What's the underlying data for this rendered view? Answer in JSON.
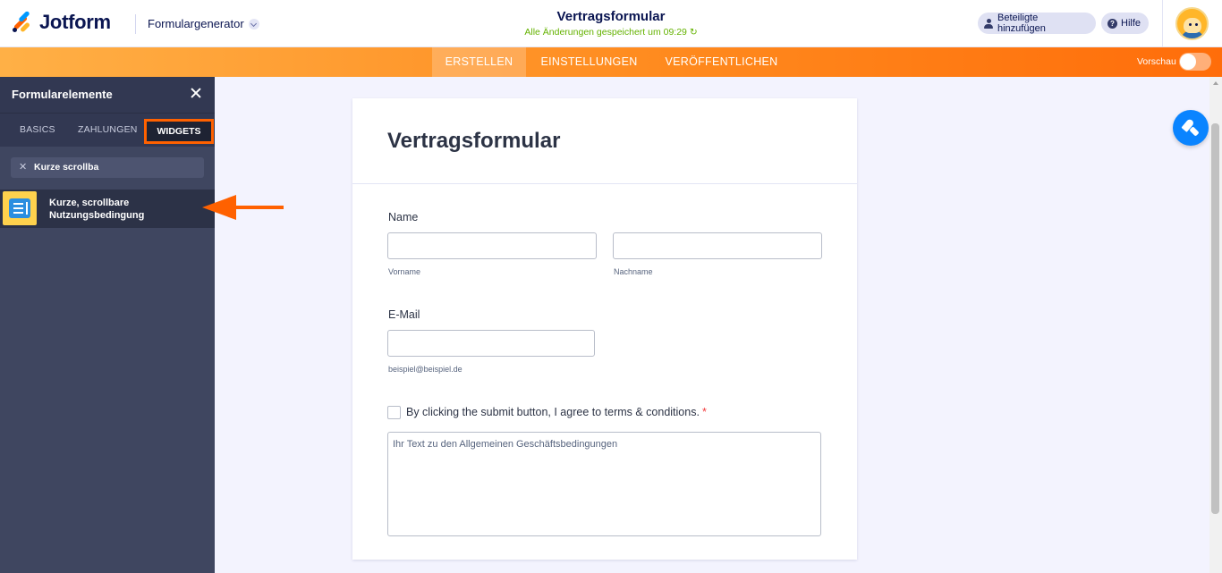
{
  "header": {
    "logo_text": "Jotform",
    "builder_label": "Formulargenerator",
    "form_title": "Vertragsformular",
    "save_status": "Alle Änderungen gespeichert um 09:29 ↻",
    "add_participants_label": "Beteiligte hinzufügen",
    "help_label": "Hilfe"
  },
  "nav": {
    "tabs": [
      {
        "label": "ERSTELLEN",
        "active": true
      },
      {
        "label": "EINSTELLUNGEN",
        "active": false
      },
      {
        "label": "VERÖFFENTLICHEN",
        "active": false
      }
    ],
    "preview_label": "Vorschau",
    "preview_enabled": false
  },
  "sidebar": {
    "title": "Formularelemente",
    "tabs": [
      {
        "label": "BASICS"
      },
      {
        "label": "ZAHLUNGEN"
      },
      {
        "label": "WIDGETS",
        "active": true
      }
    ],
    "search_value": "Kurze scrollba",
    "results": [
      {
        "label": "Kurze, scrollbare Nutzungsbedingung"
      }
    ]
  },
  "form": {
    "title": "Vertragsformular",
    "name_label": "Name",
    "first_name_sublabel": "Vorname",
    "last_name_sublabel": "Nachname",
    "email_label": "E-Mail",
    "email_sublabel": "beispiel@beispiel.de",
    "terms_checkbox_label": "By clicking the submit button, I agree to terms & conditions.",
    "required_mark": "*",
    "terms_text": "Ihr Text zu den Allgemeinen Geschäftsbedingungen"
  },
  "colors": {
    "accent_orange": "#ff6100",
    "brand_navy": "#0a1551",
    "save_green": "#64b200",
    "fab_blue": "#0a84ff"
  },
  "icons": {
    "search_clear": "close-icon",
    "sidebar_close": "close-icon",
    "fab": "paint-brush-icon"
  }
}
